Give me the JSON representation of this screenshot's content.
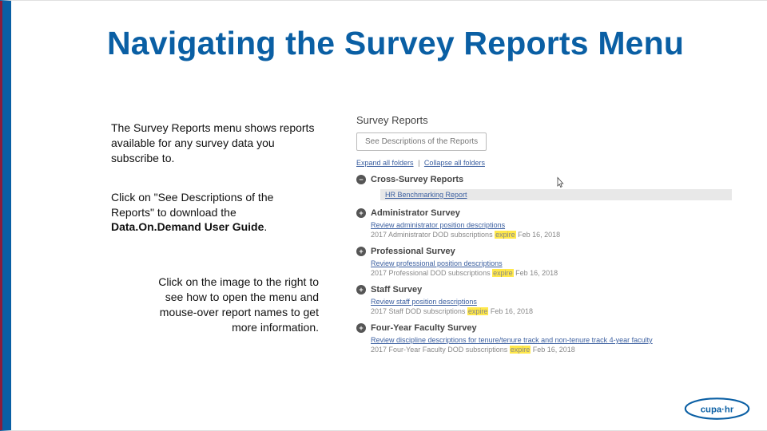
{
  "title": "Navigating the Survey Reports Menu",
  "left": {
    "p1": "The Survey Reports menu shows reports available for any survey data you subscribe to.",
    "p2a": "Click on \"See Descriptions of the Reports\" to download the ",
    "p2b": "Data.On.Demand User Guide",
    "p2c": ".",
    "p3": "Click on the image to the right to see how to open the menu and mouse-over report names to get more information."
  },
  "panel": {
    "header": "Survey Reports",
    "button": "See Descriptions of the Reports",
    "expand": "Expand all folders",
    "collapse": "Collapse all folders",
    "sep": "|",
    "folders": [
      {
        "name": "Cross-Survey Reports",
        "icon": "minus",
        "indent_item": "HR Benchmarking Report"
      },
      {
        "name": "Administrator Survey",
        "icon": "plus",
        "link": "Review administrator position descriptions",
        "meta_a": "2017 Administrator DOD subscriptions ",
        "meta_hl": "expire",
        "meta_b": " Feb 16, 2018"
      },
      {
        "name": "Professional Survey",
        "icon": "plus",
        "link": "Review professional position descriptions",
        "meta_a": "2017 Professional DOD subscriptions ",
        "meta_hl": "expire",
        "meta_b": " Feb 16, 2018"
      },
      {
        "name": "Staff Survey",
        "icon": "plus",
        "link": "Review staff position descriptions",
        "meta_a": "2017 Staff DOD subscriptions ",
        "meta_hl": "expire",
        "meta_b": " Feb 16, 2018"
      },
      {
        "name": "Four-Year Faculty Survey",
        "icon": "plus",
        "link": "Review discipline descriptions for tenure/tenure track and non-tenure track 4-year faculty",
        "meta_a": "2017 Four-Year Faculty DOD subscriptions ",
        "meta_hl": "expire",
        "meta_b": " Feb 16, 2018"
      }
    ]
  },
  "logo_text": "cupa·hr"
}
